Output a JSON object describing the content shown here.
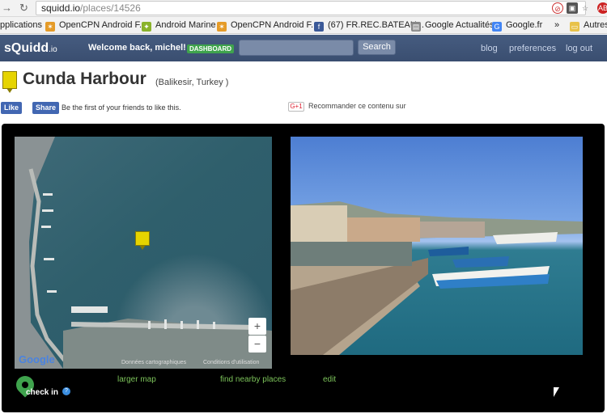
{
  "browser": {
    "url_host": "squidd.io",
    "url_path": "/places/14526"
  },
  "bookmarks": {
    "items": [
      {
        "label": "pplications"
      },
      {
        "label": "OpenCPN Android F..."
      },
      {
        "label": "Android Marine"
      },
      {
        "label": "OpenCPN Android F..."
      },
      {
        "label": "(67) FR.REC.BATEAU..."
      },
      {
        "label": "Google Actualités"
      },
      {
        "label": "Google.fr"
      },
      {
        "label": "»"
      },
      {
        "label": "Autres"
      }
    ]
  },
  "site": {
    "logo": "sQuidd",
    "logo_suffix": ".io",
    "welcome": "Welcome back, michel!",
    "dashboard": "DASHBOARD",
    "search_label": "Search",
    "nav": [
      "blog",
      "preferences",
      "log out"
    ]
  },
  "place": {
    "name": "Cunda Harbour",
    "location": "(Balikesir, Turkey )"
  },
  "social": {
    "like": "Like",
    "share": "Share",
    "like_text": "Be the first of your friends to like this.",
    "gplus": "G+1",
    "gplus_text": "Recommander ce contenu sur"
  },
  "map": {
    "zoom_in": "+",
    "zoom_out": "−",
    "google": "Google",
    "attribution": "Données cartographiques",
    "terms": "Conditions d'utilisation"
  },
  "actions": {
    "checkin": "check in",
    "info": "?",
    "larger_map": "larger map",
    "find_nearby": "find nearby places",
    "edit": "edit"
  }
}
